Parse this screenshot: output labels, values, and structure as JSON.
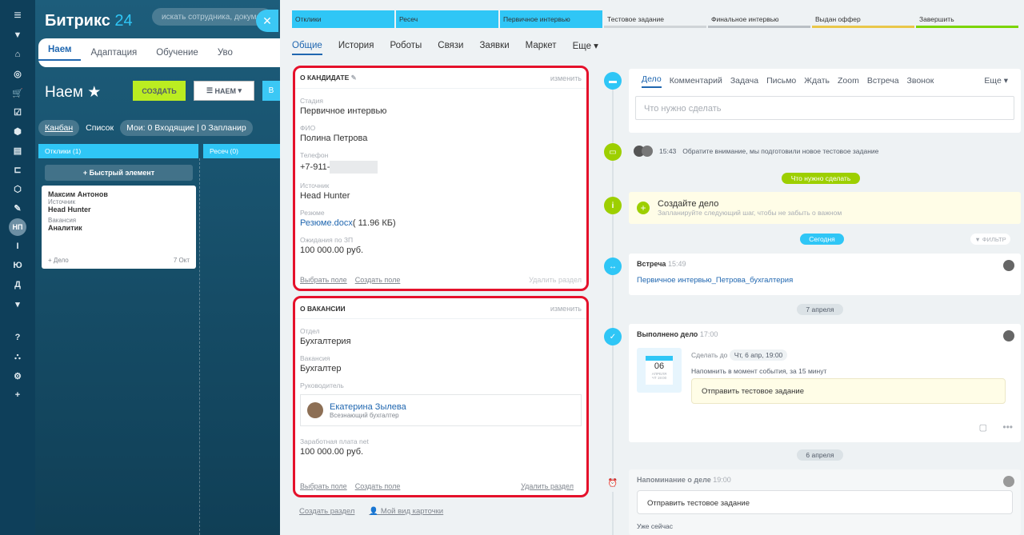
{
  "leftbar": {
    "items": [
      "≡",
      "▼",
      "⌂",
      "◎",
      "🛒",
      "☑",
      "⬢",
      "▤",
      "⊏",
      "⬡",
      "✎",
      "НП",
      "І",
      "Ю",
      "Д",
      "▾",
      "?",
      "⛬",
      "⚙",
      "+"
    ]
  },
  "bg": {
    "logo_main": "Битрикс",
    "logo_num": "24",
    "search_placeholder": "искать сотрудника, документ...",
    "tabs": [
      "Наем",
      "Адаптация",
      "Обучение",
      "Уво"
    ],
    "title": "Наем",
    "create": "СОЗДАТЬ",
    "hire": "НАЕМ",
    "views": [
      "Канбан",
      "Список"
    ],
    "mine": "Мои:",
    "incoming": "Входящие",
    "planned": "Запланир",
    "stage1": "Отклики",
    "stage1_count": "(1)",
    "stage2": "Ресеч",
    "stage2_count": "(0)",
    "quick": "+ Быстрый элемент",
    "card": {
      "name": "Максим Антонов",
      "src_label": "Источник",
      "src": "Head Hunter",
      "vac_label": "Вакансия",
      "vac": "Аналитик",
      "deal": "+ Дело",
      "date": "7 Окт"
    }
  },
  "stages": [
    {
      "label": "Отклики",
      "state": "done"
    },
    {
      "label": "Ресеч",
      "state": "done"
    },
    {
      "label": "Первичное интервью",
      "state": "done"
    },
    {
      "label": "Тестовое задание",
      "state": "next"
    },
    {
      "label": "Финальное интервью",
      "state": "next"
    },
    {
      "label": "Выдан оффер",
      "state": "next"
    },
    {
      "label": "Завершить",
      "state": "next"
    }
  ],
  "stage_colors": {
    "done": "#2fc6f6",
    "Тестовое задание": "#cfd4d7",
    "Финальное интервью": "#b9bfc4",
    "Выдан оффер": "#e9c74a",
    "Завершить": "#7bd500"
  },
  "tabs": {
    "general": "Общие",
    "history": "История",
    "robots": "Роботы",
    "links": "Связи",
    "requests": "Заявки",
    "market": "Маркет",
    "more": "Еще"
  },
  "candidate": {
    "title": "О КАНДИДАТЕ",
    "edit": "изменить",
    "stage_label": "Стадия",
    "stage": "Первичное интервью",
    "fio_label": "ФИО",
    "fio": "Полина Петрова",
    "phone_label": "Телефон",
    "phone": "+7-911-",
    "source_label": "Источник",
    "source": "Head Hunter",
    "resume_label": "Резюме",
    "resume_file": "Резюме.docx",
    "resume_size": "( 11.96 КБ)",
    "salary_label": "Ожидания по ЗП",
    "salary": "100 000.00 руб.",
    "choose": "Выбрать поле",
    "create": "Создать поле",
    "delete": "Удалить раздел"
  },
  "vacancy": {
    "title": "О ВАКАНСИИ",
    "edit": "изменить",
    "dept_label": "Отдел",
    "dept": "Бухгалтерия",
    "vac_label": "Вакансия",
    "vac": "Бухгалтер",
    "mgr_label": "Руководитель",
    "mgr_name": "Екатерина Зылева",
    "mgr_role": "Всезнающий бухгалтер",
    "salary_label": "Заработная плата net",
    "salary": "100 000.00 руб.",
    "choose": "Выбрать поле",
    "create": "Создать поле",
    "delete": "Удалить раздел"
  },
  "bottom": {
    "create_section": "Создать раздел",
    "my_view": "Мой вид карточки"
  },
  "activity": {
    "tabs": [
      "Дело",
      "Комментарий",
      "Задача",
      "Письмо",
      "Ждать",
      "Zoom",
      "Встреча",
      "Звонок"
    ],
    "more": "Еще",
    "placeholder": "Что нужно сделать"
  },
  "timeline": {
    "comment_time": "15:43",
    "comment_text": "Обратите внимание, мы подготовили новое тестовое задание",
    "todo_badge": "Что нужно сделать",
    "create_title": "Создайте дело",
    "create_sub": "Запланируйте следующий шаг, чтобы не забыть о важном",
    "today": "Сегодня",
    "filter": "ФИЛЬТР",
    "meeting_title": "Встреча",
    "meeting_time": "15:49",
    "meeting_link": "Первичное интервью_Петрова_бухгалтерия",
    "apr7": "7 апреля",
    "done_title": "Выполнено дело",
    "done_time": "17:00",
    "cal_day": "06",
    "cal_month": "АПРЕЛЯ",
    "cal_wd": "ЧТ 19:00",
    "deadline_label": "Сделать до",
    "deadline": "Чт, 6 апр, 19:00",
    "remind": "Напомнить в момент события, за 15 минут",
    "task": "Отправить тестовое задание",
    "apr6": "6 апреля",
    "reminder_title": "Напоминание о деле",
    "reminder_time": "19:00",
    "reminder_task": "Отправить тестовое задание",
    "now": "Уже сейчас"
  }
}
